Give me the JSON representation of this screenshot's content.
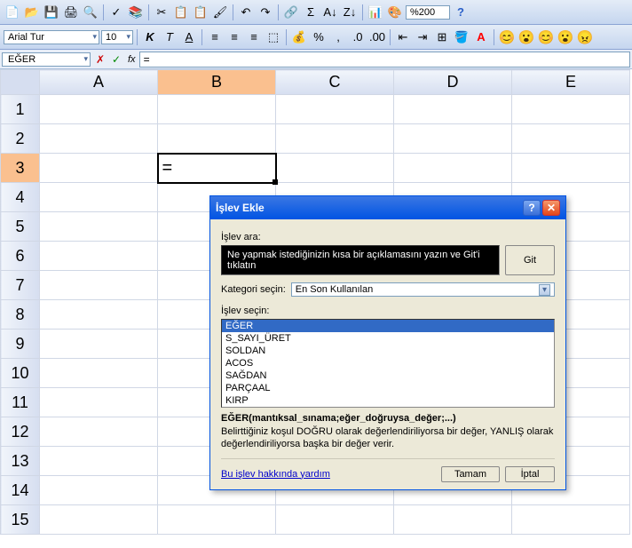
{
  "toolbar1": {
    "new": "📄",
    "open": "📂",
    "save": "💾",
    "print": "🖨",
    "preview": "🔍",
    "spell": "✓",
    "research": "📚",
    "cut": "✂",
    "copy": "📋",
    "paste": "📋",
    "fmtpaint": "🖌",
    "undo": "↶",
    "redo": "↷",
    "link": "🔗",
    "sum": "Σ",
    "sortAZ": "A↓",
    "sortZA": "Z↓",
    "chart": "📊",
    "drawing": "🎨",
    "zoom_value": "%200",
    "help": "?"
  },
  "toolbar2": {
    "font": "Arial Tur",
    "size": "10",
    "bold": "K",
    "italic": "T",
    "underline": "A",
    "alignL": "≡",
    "alignC": "≡",
    "alignR": "≡",
    "merge": "⬚",
    "currency": "💰",
    "percent": "%",
    "comma": ",",
    "decInc": ".0",
    "decDec": ".00",
    "indentDec": "⇤",
    "indentInc": "⇥",
    "borders": "⊞",
    "fill": "🪣",
    "fontcolor": "A",
    "smile1": "😊",
    "smile2": "😮",
    "smile3": "😊",
    "smile4": "😮",
    "smile5": "😠"
  },
  "formula_bar": {
    "name_box": "EĞER",
    "cancel": "✗",
    "enter": "✓",
    "fx": "fx",
    "formula": "="
  },
  "grid": {
    "columns": [
      "A",
      "B",
      "C",
      "D",
      "E"
    ],
    "rows": [
      1,
      2,
      3,
      4,
      5,
      6,
      7,
      8,
      9,
      10,
      11,
      12,
      13,
      14,
      15
    ],
    "active_cell": "B3",
    "active_value": "="
  },
  "dialog": {
    "title": "İşlev Ekle",
    "search_label": "İşlev ara:",
    "search_text": "Ne yapmak istediğinizin kısa bir açıklamasını yazın ve Git'i tıklatın",
    "go_btn": "Git",
    "category_label": "Kategori seçin:",
    "category_value": "En Son Kullanılan",
    "select_label": "İşlev seçin:",
    "functions": [
      "EĞER",
      "S_SAYI_ÜRET",
      "SOLDAN",
      "ACOS",
      "SAĞDAN",
      "PARÇAAL",
      "KIRP"
    ],
    "selected_function": "EĞER",
    "signature": "EĞER(mantıksal_sınama;eğer_doğruysa_değer;...)",
    "description": "Belirttiğiniz koşul DOĞRU olarak değerlendiriliyorsa bir değer, YANLIŞ olarak değerlendiriliyorsa başka bir değer verir.",
    "help_link": "Bu işlev hakkında yardım",
    "ok_btn": "Tamam",
    "cancel_btn": "İptal"
  }
}
